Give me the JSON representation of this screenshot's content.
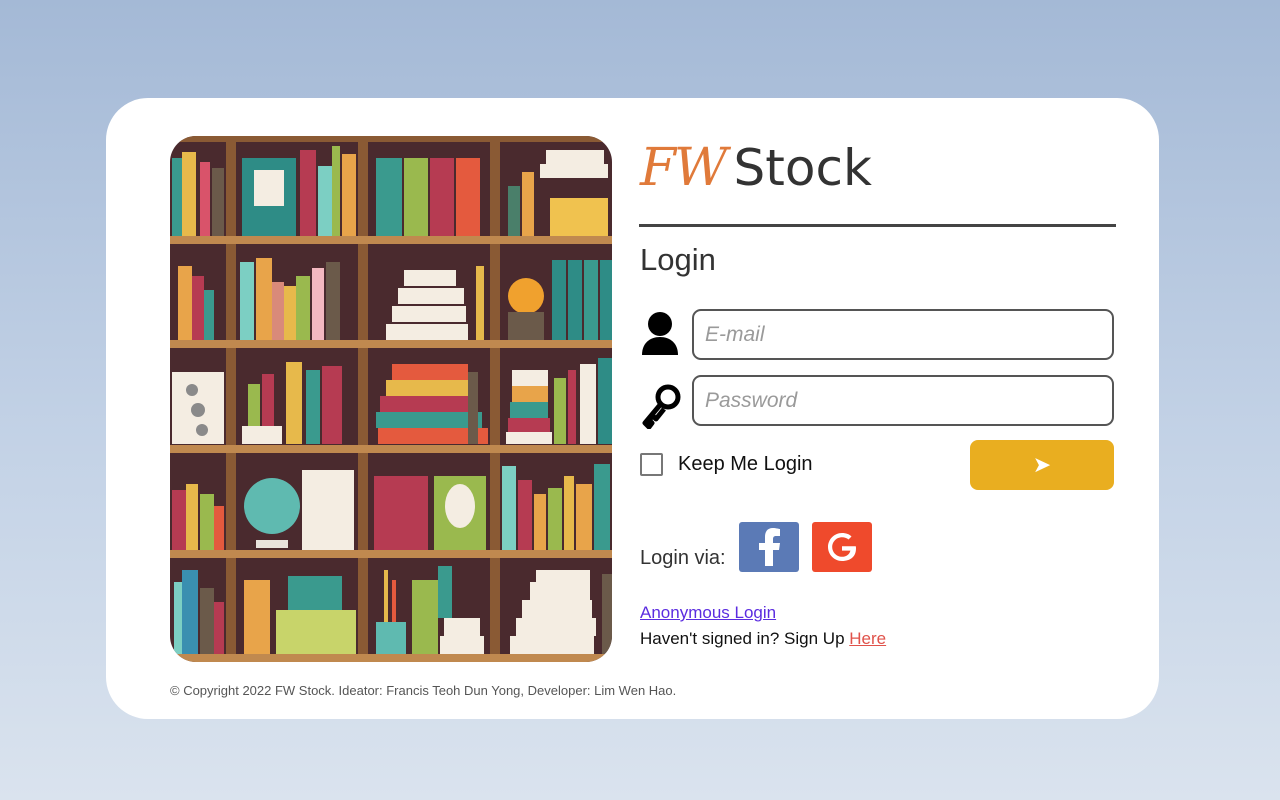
{
  "brand": {
    "prefix": "FW",
    "name": "Stock"
  },
  "login": {
    "title": "Login",
    "email_placeholder": "E-mail",
    "password_placeholder": "Password",
    "remember_label": "Keep Me Login",
    "submit_glyph": "➤",
    "via_label": "Login via:",
    "anonymous_link": "Anonymous Login",
    "signup_text": "Haven't signed in? Sign Up ",
    "signup_link": "Here"
  },
  "social": [
    {
      "name": "facebook",
      "icon": "facebook-icon",
      "color": "#5b7ab6"
    },
    {
      "name": "google",
      "icon": "google-icon",
      "color": "#ef4a2c"
    }
  ],
  "footer": {
    "copyright": "© Copyright 2022 FW Stock. Ideator: Francis Teoh Dun Yong, Developer: Lim Wen Hao."
  },
  "colors": {
    "accent": "#e07a3a",
    "submit": "#e9ae20",
    "link": "#5b2ce0",
    "signup_link": "#e0524a"
  }
}
